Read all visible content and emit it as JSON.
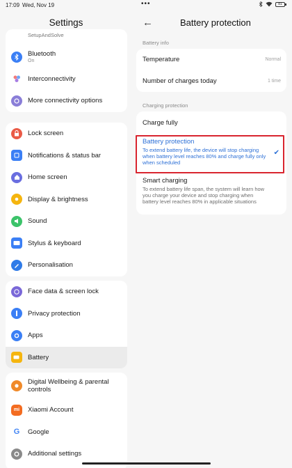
{
  "status_bar": {
    "time": "17:09",
    "date": "Wed, Nov 19",
    "dots": "•••",
    "battery": "81"
  },
  "left": {
    "title": "Settings",
    "groups": [
      {
        "items": [
          {
            "label": "SetupAndSolve",
            "icon": "setup-icon",
            "color": "#4f86ec"
          },
          {
            "label": "Bluetooth",
            "sub": "On",
            "icon": "bluetooth-icon",
            "color": "#3b7ff5"
          },
          {
            "label": "Interconnectivity",
            "icon": "interconnectivity-icon",
            "color": "#a77de3"
          },
          {
            "label": "More connectivity options",
            "icon": "connectivity-icon",
            "color": "#7a68d8"
          }
        ]
      },
      {
        "items": [
          {
            "label": "Lock screen",
            "icon": "lock-icon",
            "color": "#ea5a46"
          },
          {
            "label": "Notifications & status bar",
            "icon": "notifications-icon",
            "color": "#3b7ff5"
          },
          {
            "label": "Home screen",
            "icon": "home-icon",
            "color": "#6a6ee0"
          },
          {
            "label": "Display & brightness",
            "icon": "brightness-icon",
            "color": "#f5b50f"
          },
          {
            "label": "Sound",
            "icon": "sound-icon",
            "color": "#3cc36a"
          },
          {
            "label": "Stylus & keyboard",
            "icon": "keyboard-icon",
            "color": "#3b7ff5"
          },
          {
            "label": "Personalisation",
            "icon": "personalisation-icon",
            "color": "#2f7be8"
          }
        ]
      },
      {
        "items": [
          {
            "label": "Face data & screen lock",
            "icon": "face-icon",
            "color": "#7a68d8"
          },
          {
            "label": "Privacy protection",
            "icon": "privacy-icon",
            "color": "#3b7ff5"
          },
          {
            "label": "Apps",
            "icon": "apps-icon",
            "color": "#3b7ff5"
          },
          {
            "label": "Battery",
            "icon": "battery-icon",
            "color": "#f5b50f",
            "selected": true
          }
        ]
      },
      {
        "items": [
          {
            "label": "Digital Wellbeing & parental controls",
            "icon": "wellbeing-icon",
            "color": "#f08a2a"
          },
          {
            "label": "Xiaomi Account",
            "icon": "xiaomi-icon",
            "color": "#f36c21"
          },
          {
            "label": "Google",
            "icon": "google-icon",
            "color": "#ffffff"
          },
          {
            "label": "Additional settings",
            "icon": "gear-icon",
            "color": "#8a8a8a"
          }
        ]
      }
    ]
  },
  "right": {
    "back": "←",
    "title": "Battery protection",
    "battery_info_header": "Battery info",
    "temperature_label": "Temperature",
    "temperature_value": "Normal",
    "charges_label": "Number of charges today",
    "charges_value": "1 time",
    "charging_header": "Charging protection",
    "charge_fully": "Charge fully",
    "battery_protection_title": "Battery protection",
    "battery_protection_desc": "To extend battery life, the device will stop charging when battery level reaches 80% and charge fully only when scheduled",
    "smart_title": "Smart charging",
    "smart_desc": "To extend battery life span, the system will learn how you charge your device and stop charging when battery level reaches 80% in applicable situations",
    "check": "✔"
  }
}
